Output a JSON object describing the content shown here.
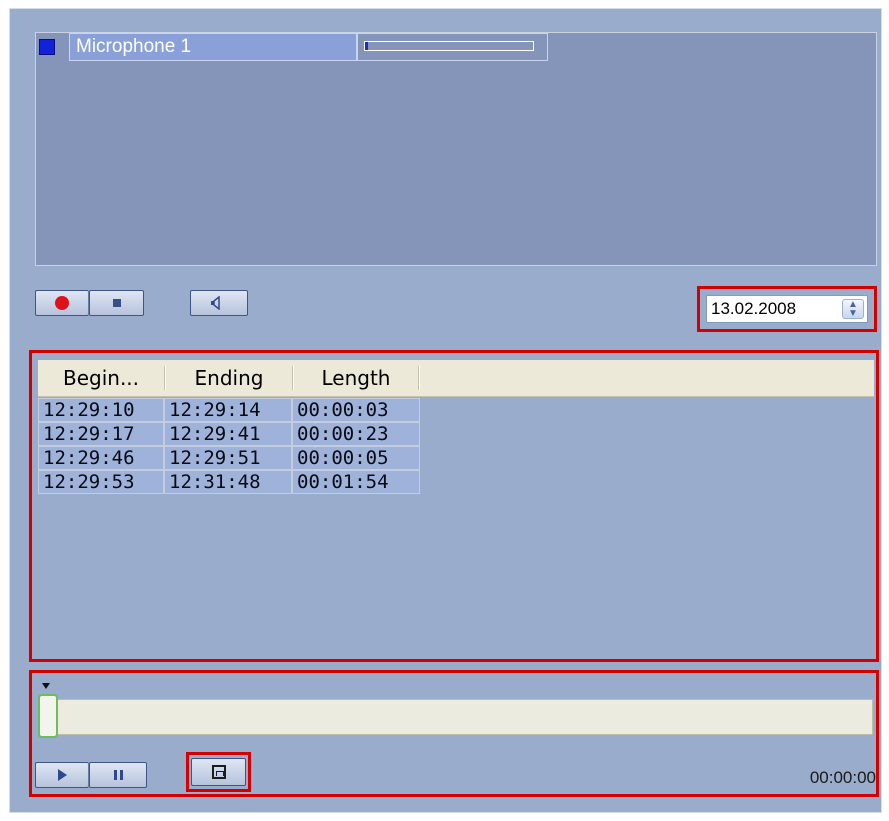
{
  "microphones": [
    {
      "name": "Microphone 1",
      "level_fraction": 0.02,
      "indicator_color": "#1122d9"
    }
  ],
  "controls": {
    "record_icon": "record-icon",
    "stop_icon": "stop-icon",
    "speaker_icon": "speaker-icon"
  },
  "date_picker": {
    "value": "13.02.2008",
    "spin_icon": "spin-up-down-icon"
  },
  "records": {
    "columns": [
      "Begin...",
      "Ending",
      "Length"
    ],
    "rows": [
      [
        "12:29:10",
        "12:29:14",
        "00:00:03"
      ],
      [
        "12:29:17",
        "12:29:41",
        "00:00:23"
      ],
      [
        "12:29:46",
        "12:29:51",
        "00:00:05"
      ],
      [
        "12:29:53",
        "12:31:48",
        "00:01:54"
      ]
    ]
  },
  "player": {
    "position_fraction": 0.0,
    "time": "00:00:00",
    "play_icon": "play-icon",
    "pause_icon": "pause-icon",
    "save_icon": "save-icon"
  },
  "colors": {
    "highlight": "#d40000",
    "panel": "#9aaccb",
    "list": "#8595b9"
  }
}
